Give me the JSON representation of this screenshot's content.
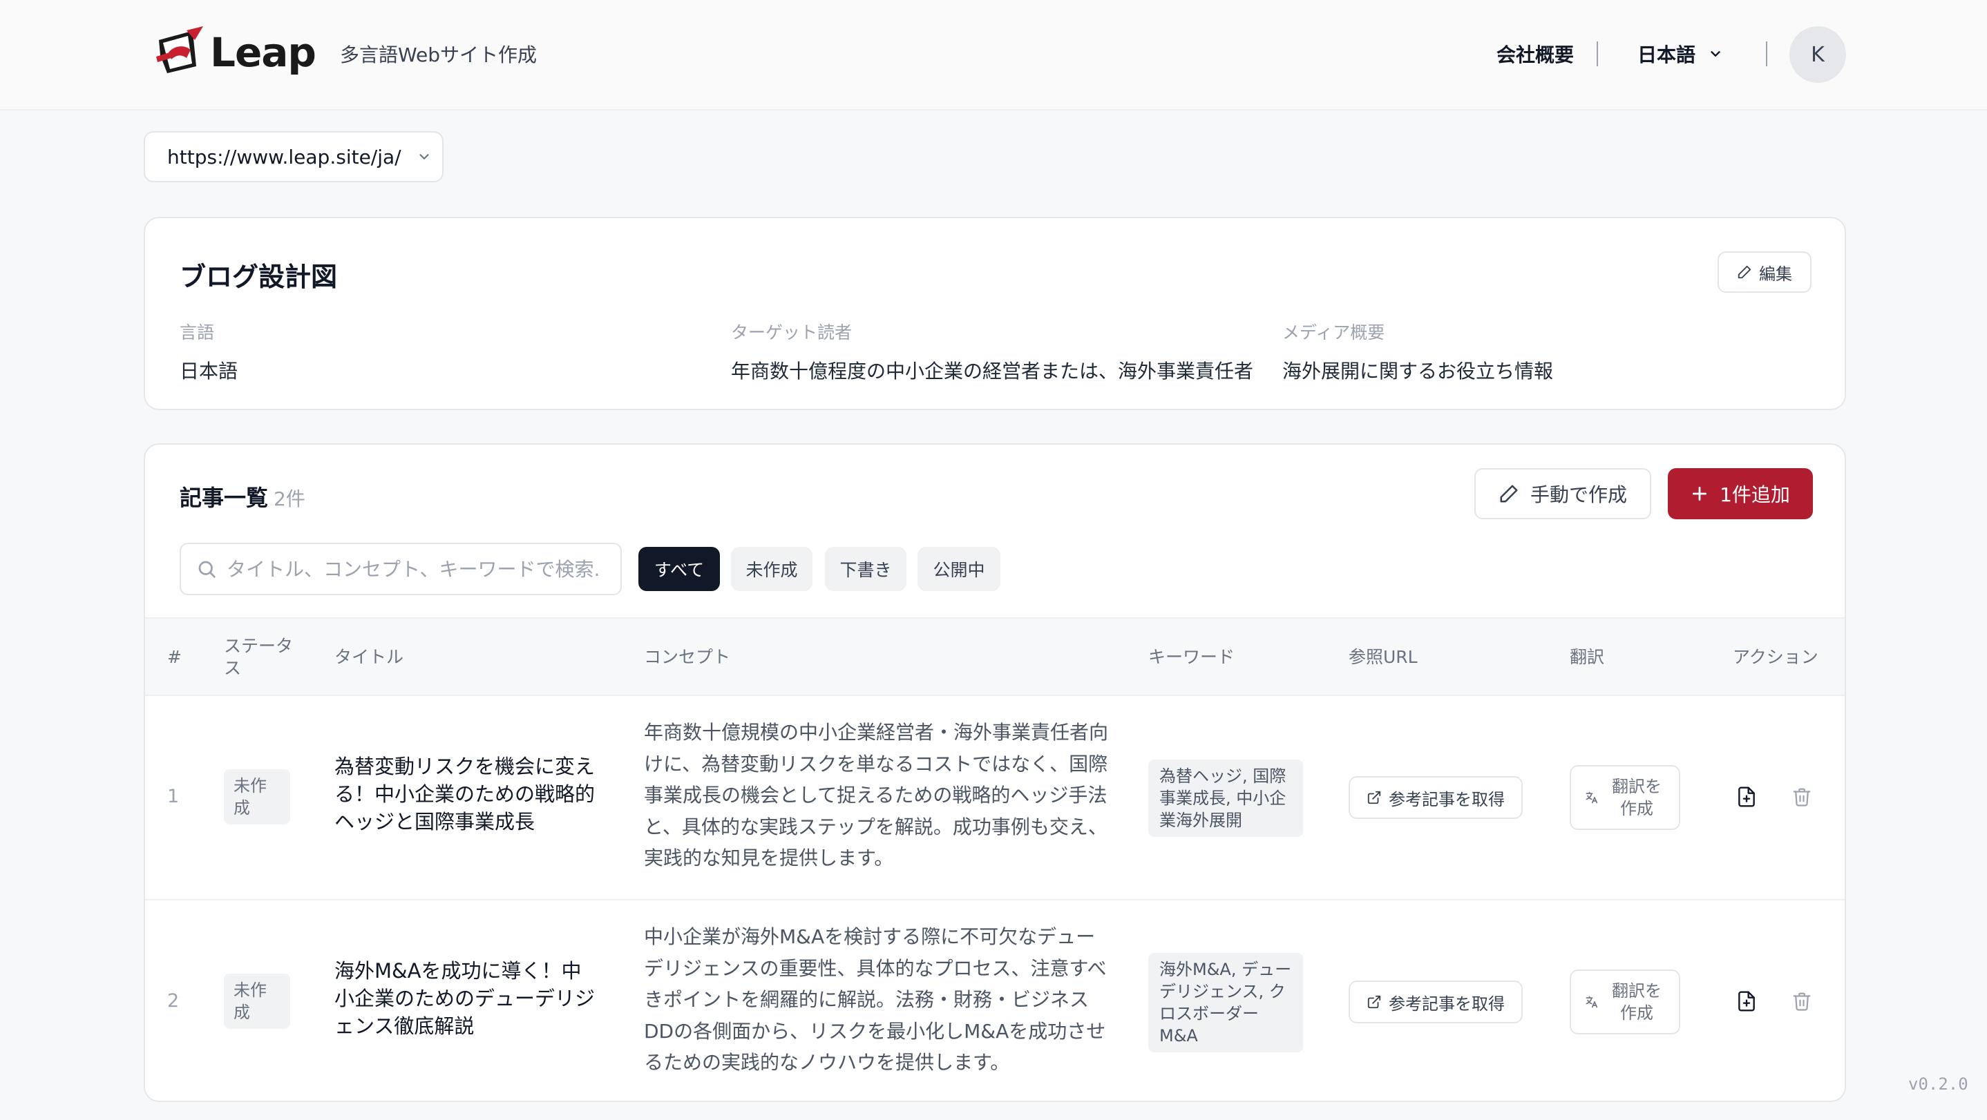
{
  "header": {
    "logo_text": "Leap",
    "tagline": "多言語Webサイト作成",
    "nav_company": "会社概要",
    "language": "日本語",
    "avatar_initial": "K"
  },
  "url_selector": {
    "value": "https://www.leap.site/ja/"
  },
  "blueprint": {
    "title": "ブログ設計図",
    "edit_label": "編集",
    "fields": [
      {
        "label": "言語",
        "value": "日本語"
      },
      {
        "label": "ターゲット読者",
        "value": "年商数十億程度の中小企業の経営者または、海外事業責任者"
      },
      {
        "label": "メディア概要",
        "value": "海外展開に関するお役立ち情報"
      }
    ]
  },
  "articles": {
    "title": "記事一覧",
    "count": "2件",
    "manual_create_label": "手動で作成",
    "add_label": "1件追加",
    "search_placeholder": "タイトル、コンセプト、キーワードで検索...",
    "filters": [
      "すべて",
      "未作成",
      "下書き",
      "公開中"
    ],
    "active_filter": "すべて",
    "columns": {
      "num": "#",
      "status": "ステータス",
      "title": "タイトル",
      "concept": "コンセプト",
      "keywords": "キーワード",
      "ref_url": "参照URL",
      "translation": "翻訳",
      "actions": "アクション"
    },
    "rows": [
      {
        "num": "1",
        "status": "未作成",
        "title": "為替変動リスクを機会に変える！中小企業のための戦略的ヘッジと国際事業成長",
        "concept": "年商数十億規模の中小企業経営者・海外事業責任者向けに、為替変動リスクを単なるコストではなく、国際事業成長の機会として捉えるための戦略的ヘッジ手法と、具体的な実践ステップを解説。成功事例も交え、実践的な知見を提供します。",
        "keywords": "為替ヘッジ, 国際事業成長, 中小企業海外展開",
        "ref_label": "参考記事を取得",
        "translate_label": "翻訳を作成"
      },
      {
        "num": "2",
        "status": "未作成",
        "title": "海外M&Aを成功に導く！中小企業のためのデューデリジェンス徹底解説",
        "concept": "中小企業が海外M&Aを検討する際に不可欠なデューデリジェンスの重要性、具体的なプロセス、注意すべきポイントを網羅的に解説。法務・財務・ビジネスDDの各側面から、リスクを最小化しM&Aを成功させるための実践的なノウハウを提供します。",
        "keywords": "海外M&A, デューデリジェンス, クロスボーダーM&A",
        "ref_label": "参考記事を取得",
        "translate_label": "翻訳を作成"
      }
    ]
  },
  "version": "v0.2.0",
  "colors": {
    "accent": "#b11d30",
    "active_filter": "#111827"
  }
}
